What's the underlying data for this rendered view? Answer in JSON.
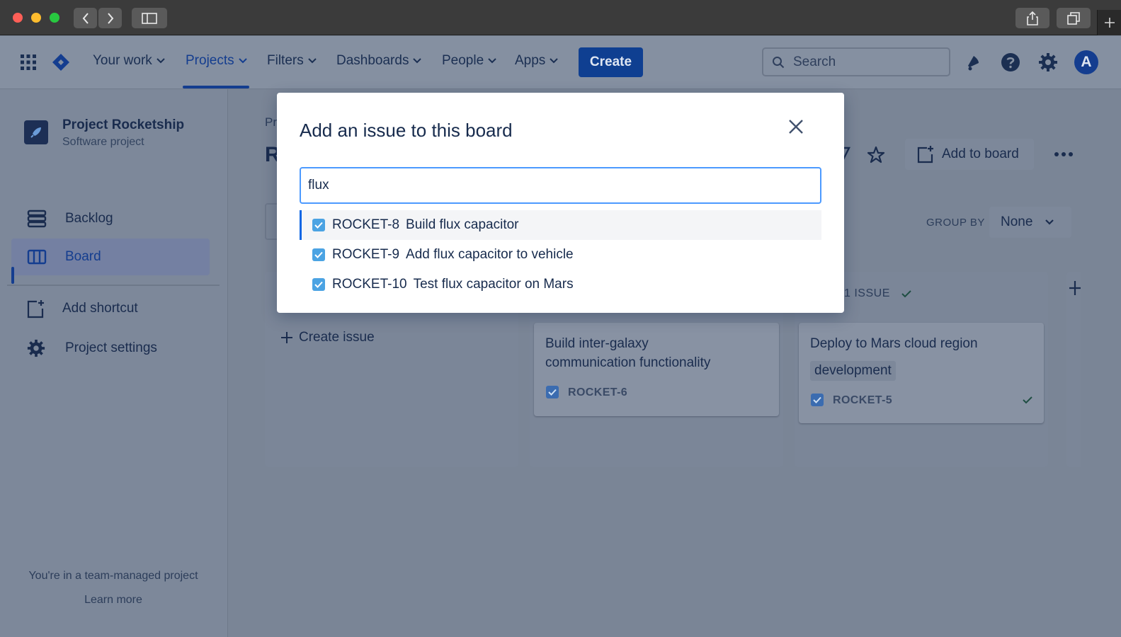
{
  "nav": {
    "items": [
      {
        "label": "Your work"
      },
      {
        "label": "Projects"
      },
      {
        "label": "Filters"
      },
      {
        "label": "Dashboards"
      },
      {
        "label": "People"
      },
      {
        "label": "Apps"
      }
    ],
    "create_label": "Create",
    "search_placeholder": "Search",
    "avatar_initial": "A"
  },
  "sidebar": {
    "project_name": "Project Rocketship",
    "project_type": "Software project",
    "items": [
      {
        "label": "Backlog"
      },
      {
        "label": "Board"
      },
      {
        "label": "Add shortcut"
      },
      {
        "label": "Project settings"
      }
    ],
    "footer_text": "You're in a team-managed project",
    "footer_link": "Learn more"
  },
  "board": {
    "breadcrumb_fragment": "Pr",
    "title_fragment": "R",
    "add_to_board_label": "Add to board",
    "group_by_label": "GROUP BY",
    "group_by_value": "None",
    "create_issue_label": "Create issue",
    "col3_count": "1 ISSUE",
    "cards": [
      {
        "title_line1": "Build inter-galaxy",
        "title_line2": "communication functionality",
        "key": "ROCKET-6"
      },
      {
        "title": "Deploy to Mars cloud region",
        "label": "development",
        "key": "ROCKET-5"
      }
    ]
  },
  "modal": {
    "title": "Add an issue to this board",
    "search_value": "flux",
    "results": [
      {
        "key": "ROCKET-8",
        "summary": "Build flux capacitor"
      },
      {
        "key": "ROCKET-9",
        "summary": "Add flux capacitor to vehicle"
      },
      {
        "key": "ROCKET-10",
        "summary": "Test flux capacitor on Mars"
      }
    ]
  },
  "colors": {
    "overlay_bg": "#7a8596",
    "accent": "#0c66e4",
    "focus_ring": "#4c9aff",
    "checkbox": "#4ba3e3"
  }
}
